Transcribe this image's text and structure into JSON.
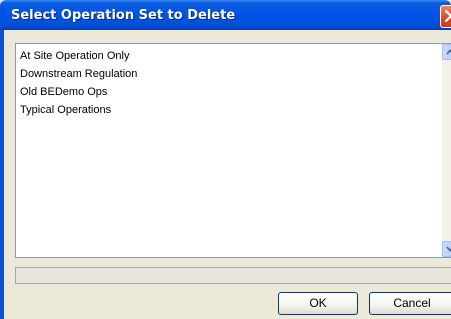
{
  "window": {
    "title": "Select Operation Set to Delete"
  },
  "list": {
    "items": [
      "At Site Operation Only",
      "Downstream Regulation",
      "Old BEDemo Ops",
      "Typical Operations"
    ]
  },
  "buttons": {
    "ok_label": "OK",
    "cancel_label": "Cancel"
  },
  "icons": {
    "close": "close-icon",
    "scroll_up": "chevron-up-icon",
    "scroll_down": "chevron-down-icon"
  },
  "colors": {
    "titlebar": "#0054e3",
    "close_button": "#d75234",
    "dialog_background": "#ece9d8"
  }
}
